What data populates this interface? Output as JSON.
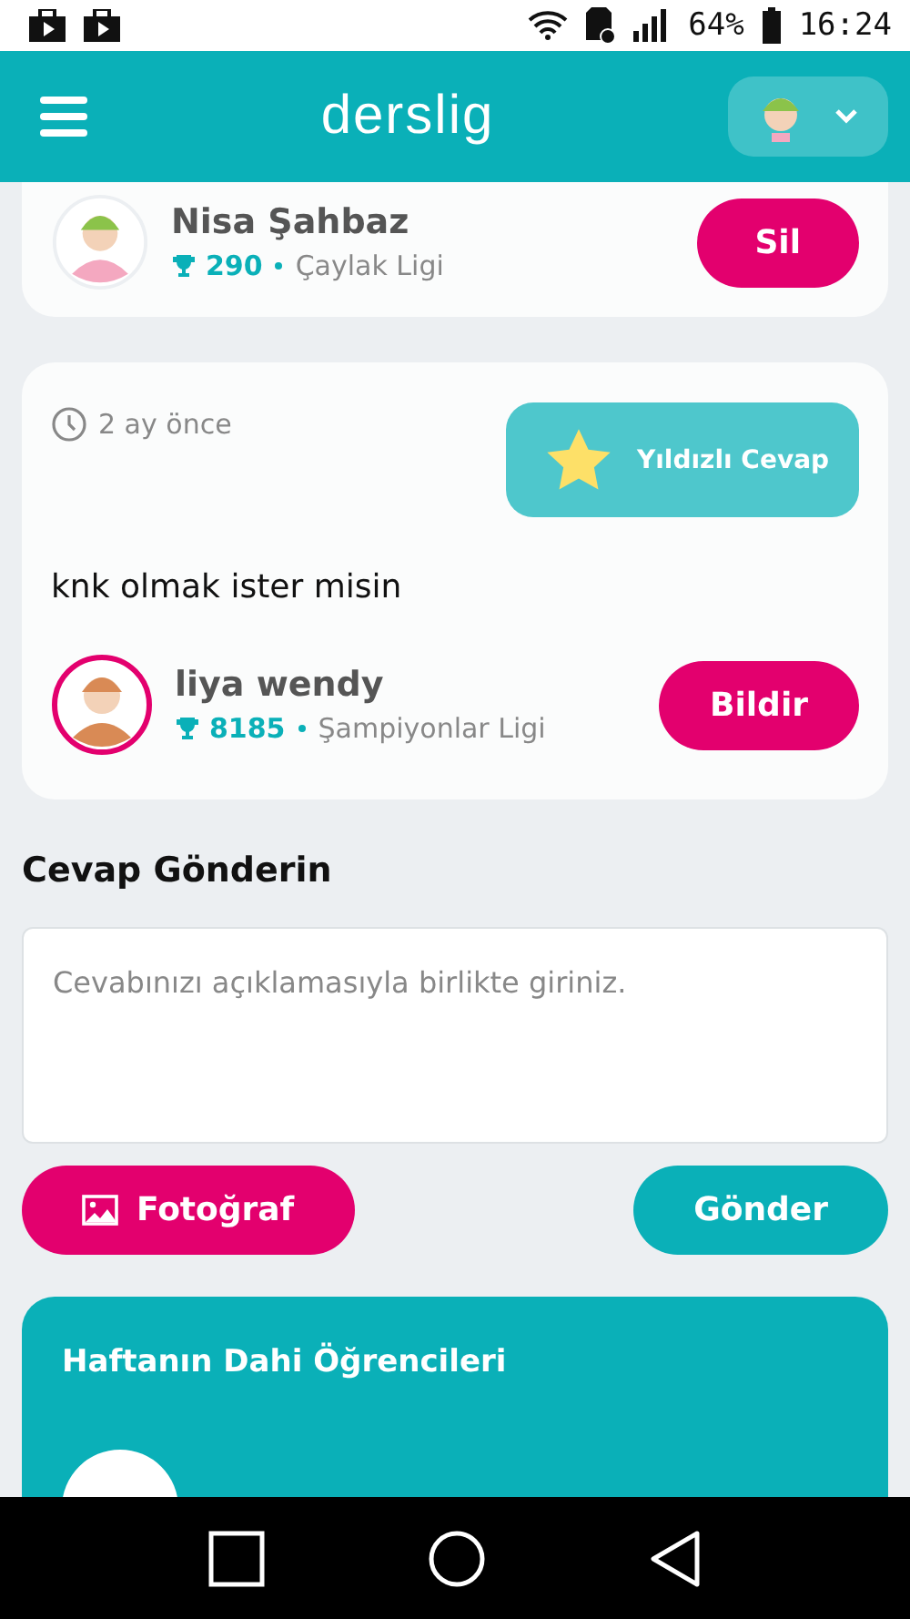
{
  "status_bar": {
    "battery": "64%",
    "time": "16:24"
  },
  "header": {
    "logo": "derslig"
  },
  "top_answer": {
    "user": {
      "name": "Nisa Şahbaz",
      "points": "290",
      "league": "Çaylak Ligi"
    },
    "button": "Sil"
  },
  "answer": {
    "time": "2 ay önce",
    "badge": "Yıldızlı Cevap",
    "text": "knk olmak ister misin",
    "user": {
      "name": "liya wendy",
      "points": "8185",
      "league": "Şampiyonlar Ligi"
    },
    "button": "Bildir"
  },
  "reply": {
    "title": "Cevap Gönderin",
    "placeholder": "Cevabınızı açıklamasıyla birlikte giriniz.",
    "photo_button": "Fotoğraf",
    "send_button": "Gönder"
  },
  "weekly": {
    "title": "Haftanın Dahi Öğrencileri"
  }
}
